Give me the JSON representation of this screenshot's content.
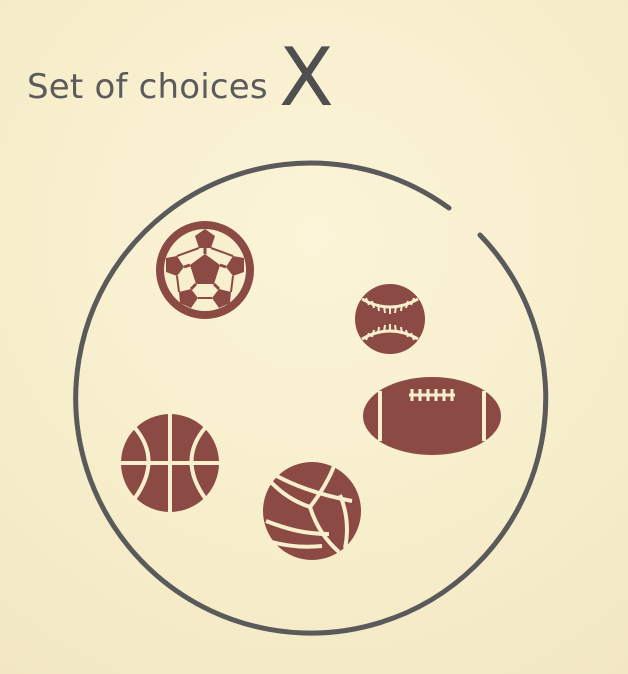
{
  "title": {
    "text": "Set of choices",
    "symbol": "X"
  },
  "set_items": [
    {
      "name": "soccer-ball",
      "icon": "soccer-ball-icon"
    },
    {
      "name": "baseball",
      "icon": "baseball-icon"
    },
    {
      "name": "american-football",
      "icon": "american-football-icon"
    },
    {
      "name": "basketball",
      "icon": "basketball-icon"
    },
    {
      "name": "volleyball",
      "icon": "volleyball-icon"
    }
  ],
  "colors": {
    "background": "#f8efcf",
    "ball": "#8b4a43",
    "outline": "#5a5a5a",
    "text": "#5b5b5b"
  }
}
